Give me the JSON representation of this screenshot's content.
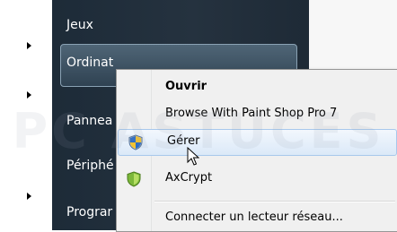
{
  "start_menu": {
    "items": [
      {
        "label": "Jeux",
        "has_arrow": true
      },
      {
        "label": "Ordinat",
        "has_arrow": false
      },
      {
        "label": "Pannea",
        "has_arrow": true
      },
      {
        "label": "Périphé",
        "has_arrow": false
      },
      {
        "label": "Prograr",
        "has_arrow": true
      }
    ],
    "highlighted": "Ordinat"
  },
  "context_menu": {
    "items": [
      {
        "label": "Ouvrir",
        "bold": true,
        "icon": null
      },
      {
        "label": "Browse With Paint Shop Pro 7",
        "bold": false,
        "icon": null
      },
      {
        "label": "Gérer",
        "bold": false,
        "icon": "shield-icon",
        "hover": true
      },
      {
        "label": "AxCrypt",
        "bold": false,
        "icon": "axcrypt-shield-icon"
      },
      {
        "label": "Connecter un lecteur réseau...",
        "bold": false,
        "icon": null
      }
    ]
  },
  "watermark": "PC ASTUCES",
  "colors": {
    "start_menu_bg": "#25323f",
    "menu_bg": "#f0f0f0",
    "hover": "#dbe9f8"
  }
}
